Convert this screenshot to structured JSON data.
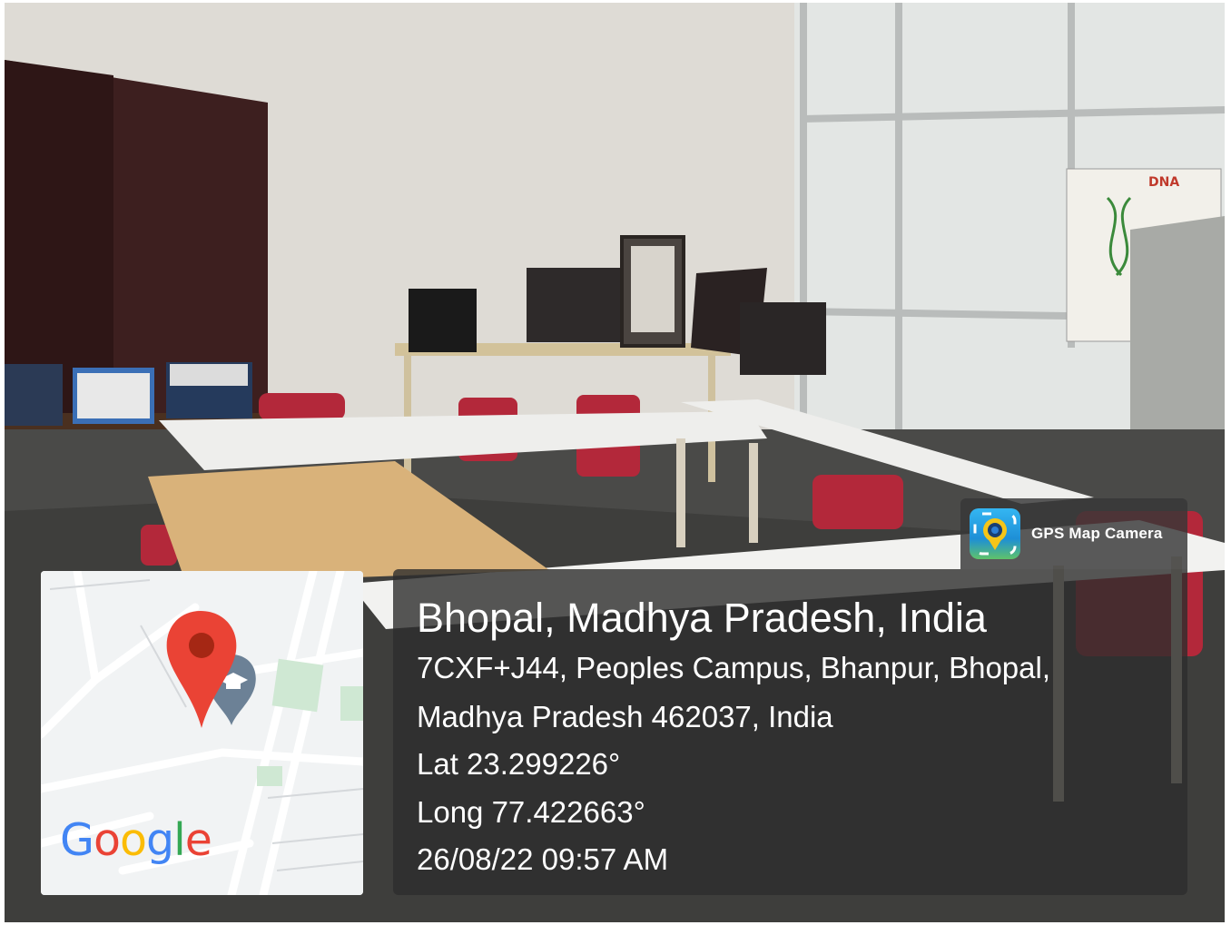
{
  "overlay": {
    "app_name": "GPS Map Camera",
    "app_icon": "map-camera-pin-icon",
    "location_title": "Bhopal, Madhya Pradesh, India",
    "address_line1": "7CXF+J44, Peoples Campus, Bhanpur, Bhopal,",
    "address_line2": "Madhya Pradesh 462037, India",
    "latitude": "Lat 23.299226°",
    "longitude": "Long 77.422663°",
    "datetime": "26/08/22 09:57 AM"
  },
  "map": {
    "brand_letters": [
      "G",
      "o",
      "o",
      "g",
      "l",
      "e"
    ],
    "brand_colors": [
      "#4285F4",
      "#EA4335",
      "#FBBC05",
      "#4285F4",
      "#34A853",
      "#EA4335"
    ],
    "pin_color": "#EA4335",
    "school_marker_icon": "graduation-cap-icon"
  },
  "photo": {
    "poster_label": "DNA",
    "subject": "classroom"
  }
}
